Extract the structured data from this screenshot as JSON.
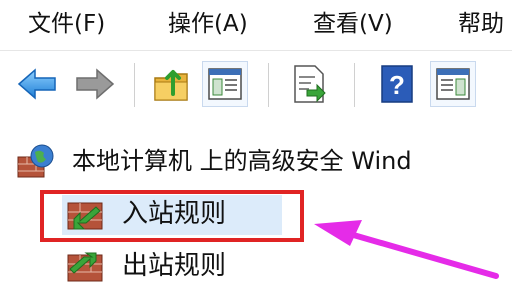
{
  "menubar": {
    "items": [
      {
        "label": "文件(F)"
      },
      {
        "label": "操作(A)"
      },
      {
        "label": "查看(V)"
      },
      {
        "label": "帮助"
      }
    ]
  },
  "toolbar": {
    "buttons": [
      {
        "icon": "back-arrow-icon"
      },
      {
        "icon": "forward-arrow-icon"
      },
      {
        "icon": "up-folder-icon"
      },
      {
        "icon": "show-hide-console-tree-icon"
      },
      {
        "icon": "export-list-icon"
      },
      {
        "icon": "help-icon"
      },
      {
        "icon": "show-hide-action-pane-icon"
      }
    ]
  },
  "tree": {
    "root_label": "本地计算机 上的高级安全 Wind",
    "inbound_label": "入站规则",
    "outbound_label": "出站规则"
  },
  "colors": {
    "highlight": "#e02424",
    "arrow": "#e52be8",
    "selection": "#dcebfa",
    "rule_icon_green": "#3aa53a",
    "rule_icon_brick": "#b5533a"
  }
}
